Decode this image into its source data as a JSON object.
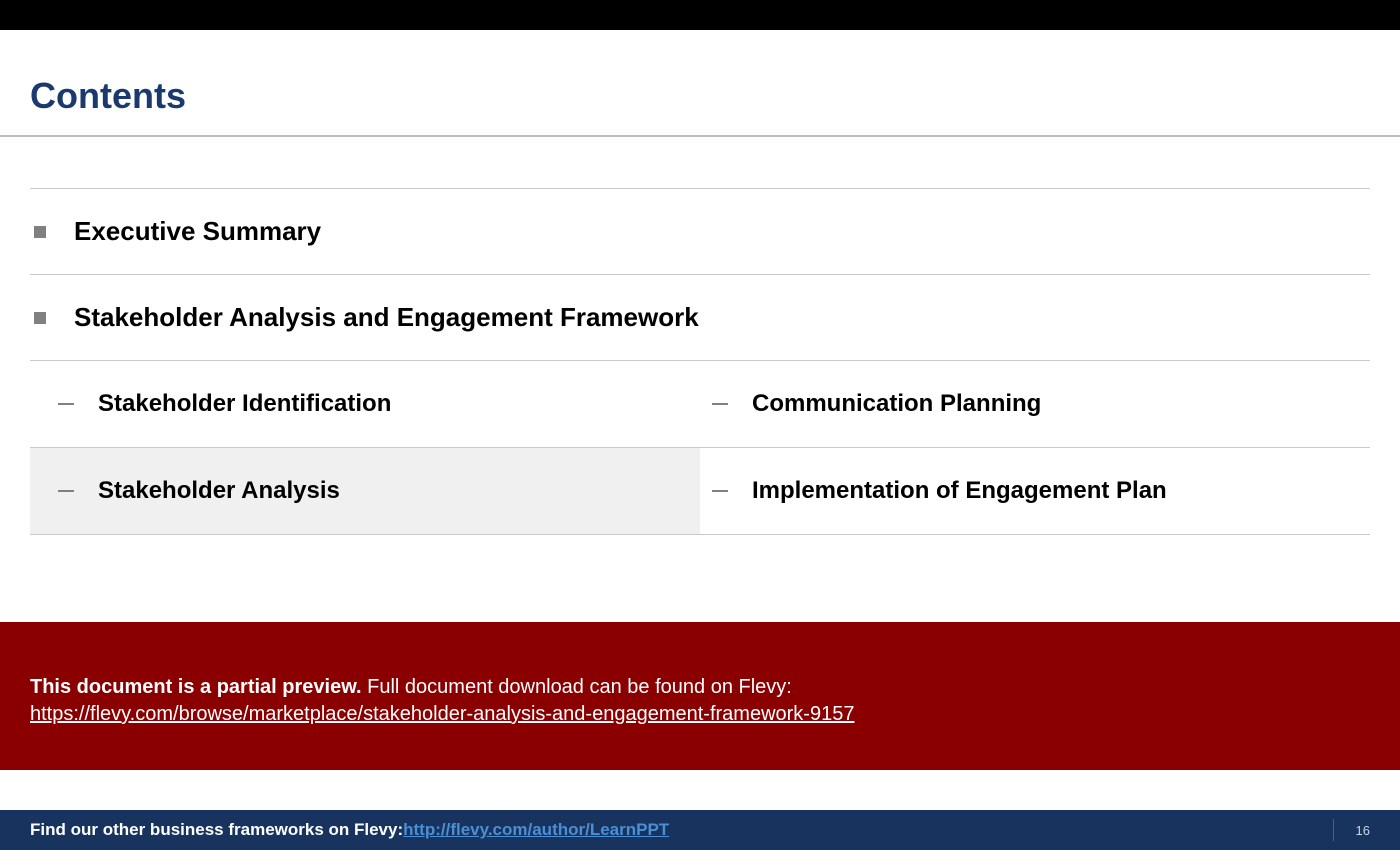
{
  "title": "Contents",
  "items": {
    "executive_summary": "Executive Summary",
    "framework": "Stakeholder Analysis and Engagement Framework",
    "sub": {
      "identification": "Stakeholder Identification",
      "analysis": "Stakeholder Analysis",
      "communication": "Communication Planning",
      "implementation": "Implementation of Engagement Plan"
    }
  },
  "preview": {
    "bold": "This document is a partial preview.",
    "rest": "  Full document download can be found on Flevy:",
    "url": "https://flevy.com/browse/marketplace/stakeholder-analysis-and-engagement-framework-9157"
  },
  "footer": {
    "prefix": "Find our other business frameworks on Flevy: ",
    "link": "http://flevy.com/author/LearnPPT",
    "page": "16"
  }
}
